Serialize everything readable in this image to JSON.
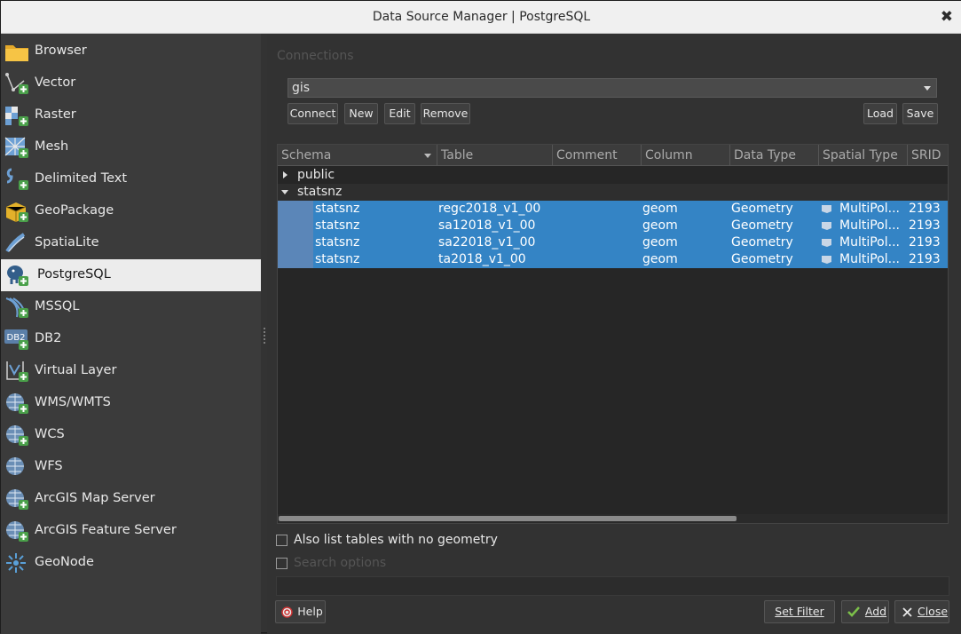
{
  "window": {
    "title": "Data Source Manager | PostgreSQL",
    "close_glyph": "✖"
  },
  "sidebar": {
    "items": [
      {
        "label": "Browser",
        "icon": "folder-icon"
      },
      {
        "label": "Vector",
        "icon": "vector-icon"
      },
      {
        "label": "Raster",
        "icon": "raster-icon"
      },
      {
        "label": "Mesh",
        "icon": "mesh-icon"
      },
      {
        "label": "Delimited Text",
        "icon": "delimited-text-icon"
      },
      {
        "label": "GeoPackage",
        "icon": "geopackage-icon"
      },
      {
        "label": "SpatiaLite",
        "icon": "spatialite-icon"
      },
      {
        "label": "PostgreSQL",
        "icon": "postgresql-icon",
        "active": true
      },
      {
        "label": "MSSQL",
        "icon": "mssql-icon"
      },
      {
        "label": "DB2",
        "icon": "db2-icon"
      },
      {
        "label": "Virtual Layer",
        "icon": "virtual-layer-icon"
      },
      {
        "label": "WMS/WMTS",
        "icon": "wms-icon"
      },
      {
        "label": "WCS",
        "icon": "wcs-icon"
      },
      {
        "label": "WFS",
        "icon": "wfs-icon"
      },
      {
        "label": "ArcGIS Map Server",
        "icon": "arcgis-map-icon"
      },
      {
        "label": "ArcGIS Feature Server",
        "icon": "arcgis-feature-icon"
      },
      {
        "label": "GeoNode",
        "icon": "geonode-icon"
      }
    ]
  },
  "connections": {
    "group_title": "Connections",
    "selected": "gis",
    "buttons": {
      "connect": "Connect",
      "new": "New",
      "edit": "Edit",
      "remove": "Remove",
      "load": "Load",
      "save": "Save"
    }
  },
  "table": {
    "columns": [
      "Schema",
      "Table",
      "Comment",
      "Column",
      "Data Type",
      "Spatial Type",
      "SRID"
    ],
    "schemas": [
      {
        "name": "public",
        "expanded": false
      },
      {
        "name": "statsnz",
        "expanded": true
      }
    ],
    "rows": [
      {
        "schema": "statsnz",
        "table": "regc2018_v1_00",
        "comment": "",
        "column": "geom",
        "data_type": "Geometry",
        "spatial_type": "MultiPol...",
        "srid": "2193"
      },
      {
        "schema": "statsnz",
        "table": "sa12018_v1_00",
        "comment": "",
        "column": "geom",
        "data_type": "Geometry",
        "spatial_type": "MultiPol...",
        "srid": "2193"
      },
      {
        "schema": "statsnz",
        "table": "sa22018_v1_00",
        "comment": "",
        "column": "geom",
        "data_type": "Geometry",
        "spatial_type": "MultiPol...",
        "srid": "2193"
      },
      {
        "schema": "statsnz",
        "table": "ta2018_v1_00",
        "comment": "",
        "column": "geom",
        "data_type": "Geometry",
        "spatial_type": "MultiPol...",
        "srid": "2193"
      }
    ]
  },
  "options": {
    "also_list": "Also list tables with no geometry",
    "search_options": "Search options"
  },
  "footer": {
    "help": "Help",
    "set_filter": "Set Filter",
    "add": "Add",
    "close": "Close"
  },
  "colors": {
    "selection": "#3484c5",
    "active_item": "#ececec"
  }
}
